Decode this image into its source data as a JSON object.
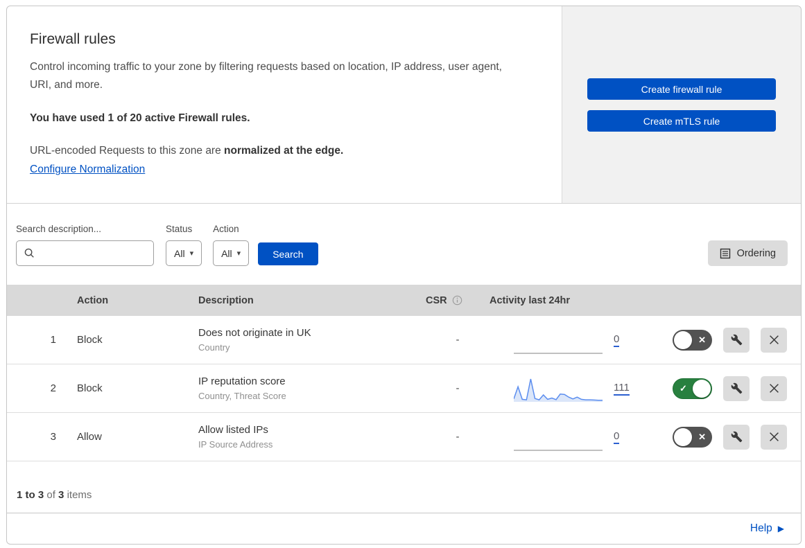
{
  "header": {
    "title": "Firewall rules",
    "description": "Control incoming traffic to your zone by filtering requests based on location, IP address, user agent, URI, and more.",
    "usage": "You have used 1 of 20 active Firewall rules.",
    "normalization_prefix": "URL-encoded Requests to this zone are ",
    "normalization_bold": "normalized at the edge.",
    "normalization_link": "Configure Normalization"
  },
  "panel": {
    "create_firewall_label": "Create firewall rule",
    "create_mtls_label": "Create mTLS rule"
  },
  "filters": {
    "search_label": "Search description...",
    "search_value": "",
    "search_placeholder": "",
    "status_label": "Status",
    "status_value": "All",
    "action_label": "Action",
    "action_value": "All",
    "search_button_label": "Search",
    "ordering_button_label": "Ordering"
  },
  "table": {
    "headers": {
      "action": "Action",
      "description": "Description",
      "csr": "CSR",
      "activity": "Activity last 24hr"
    },
    "rows": [
      {
        "priority": "1",
        "action": "Block",
        "description": "Does not originate in UK",
        "criteria": "Country",
        "csr": "-",
        "activity_count": "0",
        "enabled": false,
        "sparkline": []
      },
      {
        "priority": "2",
        "action": "Block",
        "description": "IP reputation score",
        "criteria": "Country, Threat Score",
        "csr": "-",
        "activity_count": "111",
        "enabled": true,
        "sparkline": [
          10,
          65,
          8,
          6,
          100,
          12,
          6,
          28,
          8,
          14,
          7,
          32,
          30,
          18,
          10,
          18,
          8,
          6,
          6,
          5,
          4,
          4
        ]
      },
      {
        "priority": "3",
        "action": "Allow",
        "description": "Allow listed IPs",
        "criteria": "IP Source Address",
        "csr": "-",
        "activity_count": "0",
        "enabled": false,
        "sparkline": []
      }
    ]
  },
  "pagination": {
    "range": "1 to 3",
    "of_label": "of",
    "total": "3",
    "items_label": "items"
  },
  "footer": {
    "help_label": "Help"
  },
  "icons": {
    "toggle_off_x": "✕",
    "toggle_on_check": "✓",
    "chevron_down": "▾",
    "help_arrow": "▶"
  },
  "colors": {
    "accent_blue": "#0051c3",
    "link_blue": "#0051c3",
    "toggle_on_green": "#28803f",
    "toggle_off_gray": "#525252",
    "header_band_gray": "#d9d9d9",
    "panel_gray": "#f1f1f1",
    "sparkline_blue": "#5b8def",
    "sparkline_fill": "#dbe6f9"
  }
}
